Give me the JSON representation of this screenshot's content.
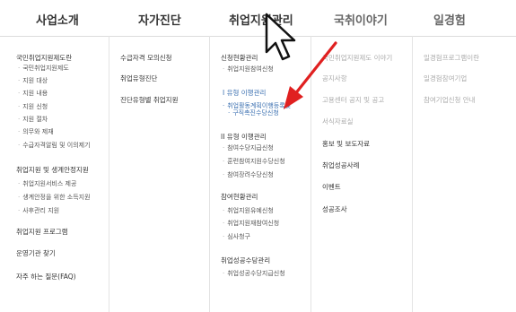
{
  "topnav": {
    "tabs": [
      {
        "label": "사업소개"
      },
      {
        "label": "자가진단"
      },
      {
        "label": "취업지원관리"
      },
      {
        "label": "국취이야기"
      },
      {
        "label": "일경험"
      }
    ]
  },
  "col1": {
    "title": "국민취업지원제도란",
    "subs": [
      "국민취업지원제도",
      "지원 대상",
      "지원 내용",
      "지원 신청",
      "지원 절차",
      "의무와 제재",
      "수급자격알림 및 이의제기"
    ],
    "title2": "취업지원 및 생계안정지원",
    "subs2": [
      "취업지원서비스 제공",
      "생계안정을 위한 소득지원",
      "사후관리 지원"
    ],
    "item3": "취업지원 프로그램",
    "item4": "운영기관 찾기",
    "item5": "자주 하는 질문(FAQ)"
  },
  "col2": {
    "items": [
      "수급자격 모의신청",
      "취업유형진단",
      "진단유형별 취업지원"
    ]
  },
  "col3": {
    "title": "신청현황관리",
    "subs": [
      "취업지원참여신청"
    ],
    "sec1": "I 유형 이행관리",
    "subs1": [
      "취업활동계획이행등록및",
      "구직촉진수당신청"
    ],
    "sec2": "II 유형 이행관리",
    "subs2": [
      "참여수당지급신청",
      "훈련참여지원수당신청",
      "참여장려수당신청"
    ],
    "sec3": "참여현황관리",
    "subs3": [
      "취업지원유예신청",
      "취업지원재참여신청",
      "심사청구"
    ],
    "sec4": "취업성공수당관리",
    "subs4": [
      "취업성공수당지급신청"
    ]
  },
  "col4": {
    "items": [
      "국민취업지원제도 이야기",
      "공지사항",
      "고용센터 공지 및 공고",
      "서식자료실",
      "홍보 및 보도자료",
      "취업성공사례",
      "이벤트",
      "성공조사"
    ]
  },
  "col5": {
    "items": [
      "일경험프로그램이란",
      "일경험참여기업",
      "참여기업신청 안내"
    ]
  },
  "colors": {
    "text": "#333333",
    "highlight": "#3a6fb0",
    "arrow": "#e02020"
  },
  "icons": {
    "cursor": "mouse-pointer-icon",
    "annotation": "red-arrow-icon"
  }
}
